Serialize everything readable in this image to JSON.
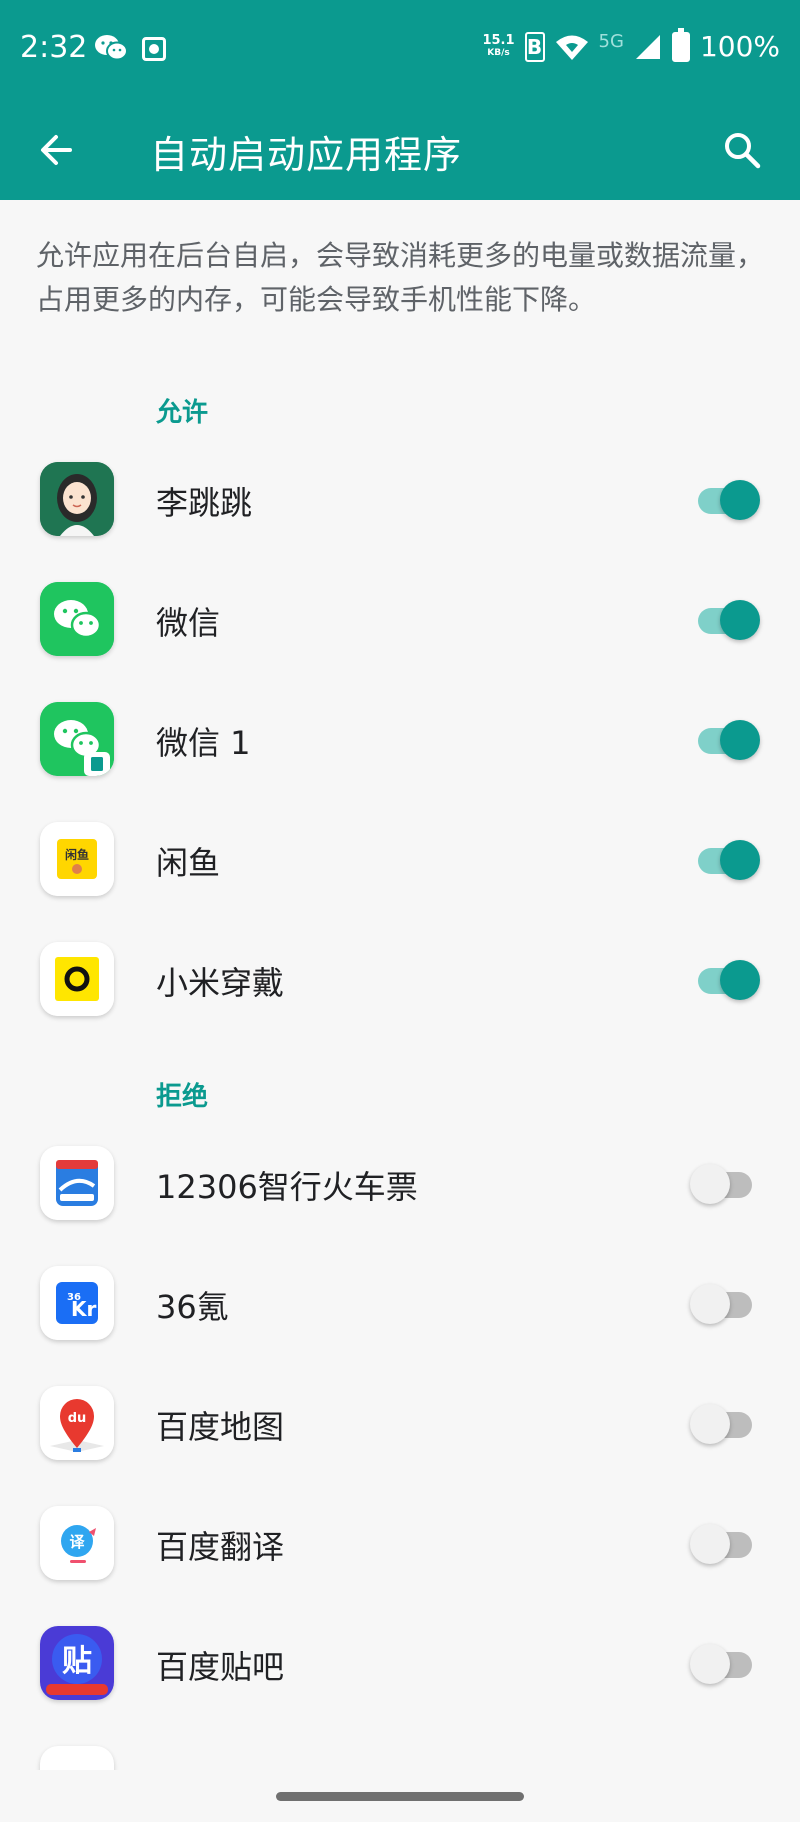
{
  "status_bar": {
    "time": "2:32",
    "net_speed_value": "15.1",
    "net_speed_unit": "KB/s",
    "hd": "B",
    "network_type": "5G",
    "battery": "100%",
    "icons": [
      "wechat-icon",
      "camera-icon",
      "wifi-icon",
      "signal-icon",
      "battery-icon"
    ]
  },
  "app_bar": {
    "title": "自动启动应用程序",
    "back_icon": "arrow-left-icon",
    "search_icon": "search-icon",
    "color": "#0b9a8f"
  },
  "description": "允许应用在后台自启，会导致消耗更多的电量或数据流量，占用更多的内存，可能会导致手机性能下降。",
  "sections": {
    "allowed": {
      "label": "允许",
      "apps": [
        {
          "name": "李跳跳",
          "icon": "li-tiaotiao-icon",
          "enabled": true
        },
        {
          "name": "微信",
          "icon": "wechat-icon",
          "enabled": true
        },
        {
          "name": "微信 1",
          "icon": "wechat-clone-icon",
          "enabled": true
        },
        {
          "name": "闲鱼",
          "icon": "xianyu-icon",
          "enabled": true
        },
        {
          "name": "小米穿戴",
          "icon": "mi-wear-icon",
          "enabled": true
        }
      ]
    },
    "denied": {
      "label": "拒绝",
      "apps": [
        {
          "name": "12306智行火车票",
          "icon": "train-ticket-icon",
          "enabled": false
        },
        {
          "name": "36氪",
          "icon": "36kr-icon",
          "enabled": false
        },
        {
          "name": "百度地图",
          "icon": "baidu-map-icon",
          "enabled": false
        },
        {
          "name": "百度翻译",
          "icon": "baidu-translate-icon",
          "enabled": false
        },
        {
          "name": "百度贴吧",
          "icon": "baidu-tieba-icon",
          "enabled": false
        }
      ]
    }
  },
  "colors": {
    "accent": "#0b9a8f",
    "toggle_on_track": "#7fd0c9",
    "toggle_off_track": "#bdbdbd"
  }
}
